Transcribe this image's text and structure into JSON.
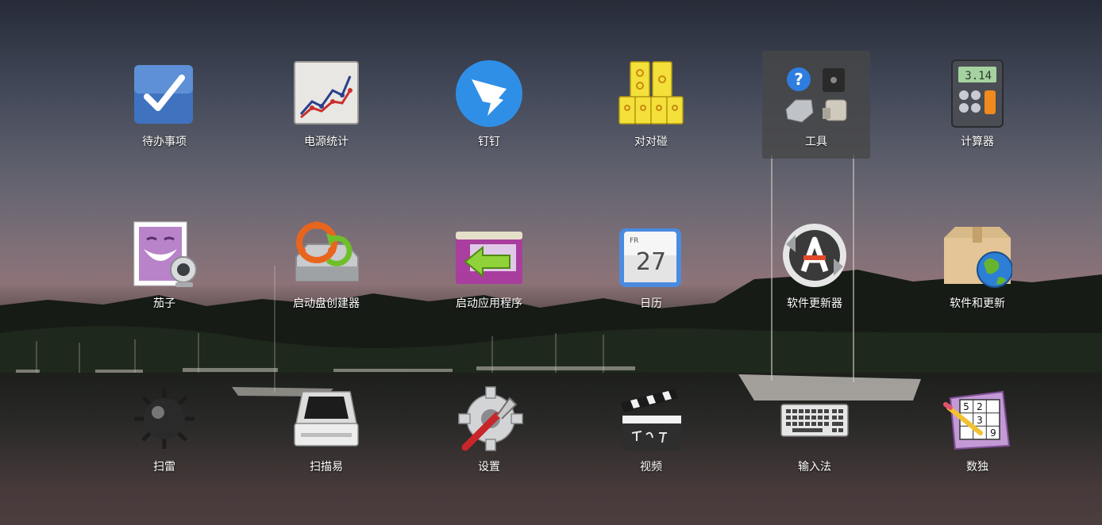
{
  "launcher": {
    "apps": [
      {
        "label": "待办事项",
        "icon": "checkmark-icon"
      },
      {
        "label": "电源统计",
        "icon": "power-chart-icon"
      },
      {
        "label": "钉钉",
        "icon": "dingtalk-icon"
      },
      {
        "label": "对对碰",
        "icon": "game-blocks-icon"
      },
      {
        "label": "工具",
        "icon": "tools-folder-icon",
        "selected": true
      },
      {
        "label": "计算器",
        "icon": "calculator-icon",
        "display": "3.14"
      },
      {
        "label": "茄子",
        "icon": "webcam-icon"
      },
      {
        "label": "启动盘创建器",
        "icon": "startup-disk-icon"
      },
      {
        "label": "启动应用程序",
        "icon": "startup-apps-icon"
      },
      {
        "label": "日历",
        "icon": "calendar-icon",
        "day": "FR",
        "date": "27"
      },
      {
        "label": "软件更新器",
        "icon": "software-updater-icon"
      },
      {
        "label": "软件和更新",
        "icon": "software-sources-icon"
      },
      {
        "label": "扫雷",
        "icon": "mine-icon"
      },
      {
        "label": "扫描易",
        "icon": "scanner-icon"
      },
      {
        "label": "设置",
        "icon": "settings-icon"
      },
      {
        "label": "视频",
        "icon": "video-clapper-icon"
      },
      {
        "label": "输入法",
        "icon": "keyboard-icon"
      },
      {
        "label": "数独",
        "icon": "sudoku-icon",
        "cells": [
          "5",
          "2",
          "3",
          "9"
        ]
      }
    ]
  }
}
